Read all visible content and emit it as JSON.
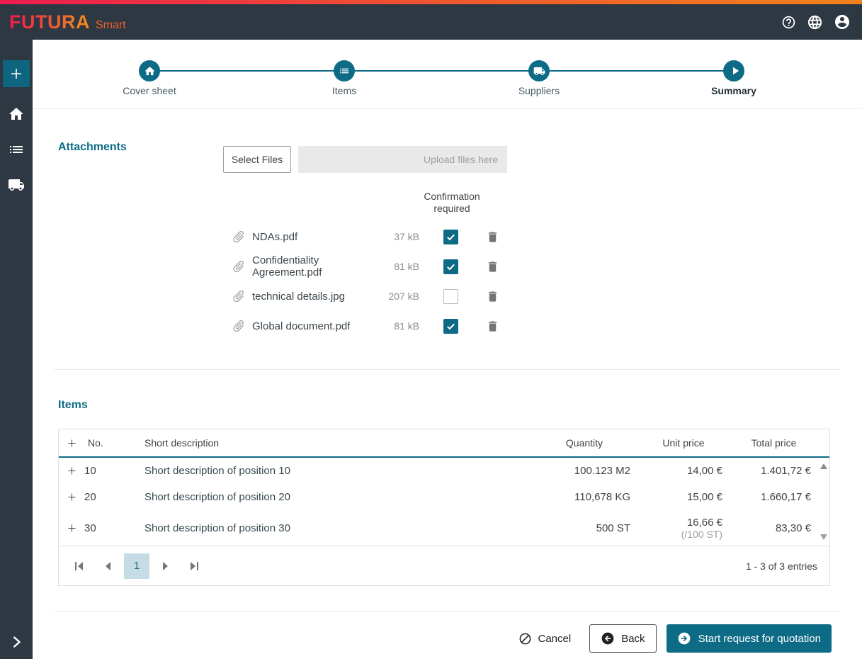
{
  "header": {
    "brand": "FUTURA",
    "brand_suffix": "Smart"
  },
  "stepper": {
    "steps": [
      {
        "label": "Cover sheet",
        "icon": "home-icon",
        "active": false
      },
      {
        "label": "Items",
        "icon": "list-icon",
        "active": false
      },
      {
        "label": "Suppliers",
        "icon": "truck-icon",
        "active": false
      },
      {
        "label": "Summary",
        "icon": "play-icon",
        "active": true
      }
    ]
  },
  "attachments": {
    "title": "Attachments",
    "select_files_label": "Select Files",
    "dropzone_placeholder": "Upload files here",
    "confirmation_header": "Confirmation required",
    "files": [
      {
        "name": "NDAs.pdf",
        "size": "37 kB",
        "confirmation_required": true
      },
      {
        "name": "Confidentiality Agreement.pdf",
        "size": "81 kB",
        "confirmation_required": true
      },
      {
        "name": "technical details.jpg",
        "size": "207 kB",
        "confirmation_required": false
      },
      {
        "name": "Global document.pdf",
        "size": "81 kB",
        "confirmation_required": true
      }
    ]
  },
  "items": {
    "title": "Items",
    "columns": {
      "no": "No.",
      "short_description": "Short description",
      "quantity": "Quantity",
      "unit_price": "Unit price",
      "total_price": "Total price"
    },
    "rows": [
      {
        "no": "10",
        "description": "Short description of position 10",
        "quantity": "100.123 M2",
        "unit_price": "14,00 €",
        "unit_price_note": "",
        "total_price": "1.401,72 €"
      },
      {
        "no": "20",
        "description": "Short description of position 20",
        "quantity": "110,678 KG",
        "unit_price": "15,00 €",
        "unit_price_note": "",
        "total_price": "1.660,17 €"
      },
      {
        "no": "30",
        "description": "Short description of position 30",
        "quantity": "500 ST",
        "unit_price": "16,66 €",
        "unit_price_note": "(/100 ST)",
        "total_price": "83,30 €"
      }
    ],
    "pagination": {
      "current_page": "1",
      "summary": "1 - 3 of 3 entries"
    }
  },
  "footer": {
    "cancel_label": "Cancel",
    "back_label": "Back",
    "submit_label": "Start request for quotation"
  },
  "icons": {
    "header": [
      "help-icon",
      "globe-icon",
      "user-icon"
    ],
    "sidebar": [
      "plus-icon",
      "home-icon",
      "list-icon",
      "truck-icon",
      "chevron-right-icon"
    ],
    "stepper": [
      "home-icon",
      "list-icon",
      "truck-icon",
      "play-icon"
    ],
    "attachments": [
      "paperclip-icon",
      "checkbox-check-icon",
      "trash-icon"
    ],
    "table": [
      "expand-plus-icon",
      "scroll-up-icon",
      "scroll-down-icon"
    ],
    "pagination": [
      "first-page-icon",
      "prev-page-icon",
      "next-page-icon",
      "last-page-icon"
    ],
    "footer": [
      "ban-icon",
      "arrow-left-circle-icon",
      "arrow-right-circle-icon"
    ]
  },
  "colors": {
    "accent_teal": "#0d6b85",
    "header_bg": "#2d3842",
    "gradient_start": "#ec1c4f",
    "gradient_end": "#f0821c",
    "pagination_active_bg": "#c6dce5"
  }
}
